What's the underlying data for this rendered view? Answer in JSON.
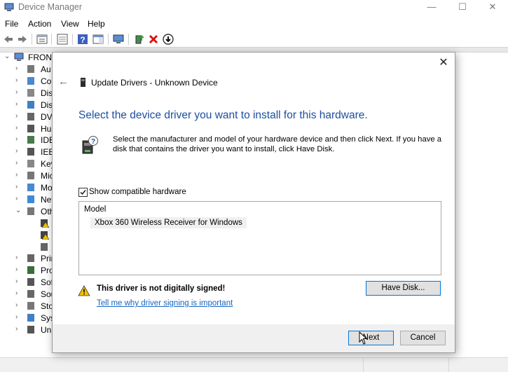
{
  "window": {
    "title": "Device Manager",
    "controls": {
      "minimize": "—",
      "maximize": "☐",
      "close": "✕"
    }
  },
  "menu": [
    "File",
    "Action",
    "View",
    "Help"
  ],
  "tree": {
    "root_label": "FRONT",
    "items": [
      {
        "label": "Au",
        "icon": "audio-icon",
        "expanded": false
      },
      {
        "label": "Cor",
        "icon": "computer-icon",
        "expanded": false
      },
      {
        "label": "Disk",
        "icon": "disk-icon",
        "expanded": false
      },
      {
        "label": "Disp",
        "icon": "display-icon",
        "expanded": false
      },
      {
        "label": "DVD",
        "icon": "dvd-icon",
        "expanded": false
      },
      {
        "label": "Hun",
        "icon": "hid-icon",
        "expanded": false
      },
      {
        "label": "IDE",
        "icon": "ide-icon",
        "expanded": false
      },
      {
        "label": "IEEE",
        "icon": "ieee-icon",
        "expanded": false
      },
      {
        "label": "Key",
        "icon": "keyboard-icon",
        "expanded": false
      },
      {
        "label": "Mic",
        "icon": "mouse-icon",
        "expanded": false
      },
      {
        "label": "Mo",
        "icon": "monitor-icon",
        "expanded": false
      },
      {
        "label": "Net",
        "icon": "network-icon",
        "expanded": false
      },
      {
        "label": "Oth",
        "icon": "other-devices-icon",
        "expanded": true
      },
      {
        "label": "",
        "icon": "unknown-device-warning-icon",
        "child": true
      },
      {
        "label": "",
        "icon": "unknown-device-warning-icon",
        "child": true
      },
      {
        "label": "",
        "icon": "unknown-device-icon",
        "child": true
      },
      {
        "label": "Prin",
        "icon": "printer-icon",
        "expanded": false
      },
      {
        "label": "Pro",
        "icon": "processor-icon",
        "expanded": false
      },
      {
        "label": "Sof",
        "icon": "software-icon",
        "expanded": false
      },
      {
        "label": "Sou",
        "icon": "sound-icon",
        "expanded": false
      },
      {
        "label": "Sto",
        "icon": "storage-icon",
        "expanded": false
      },
      {
        "label": "Syst",
        "icon": "system-icon",
        "expanded": false
      },
      {
        "label": "Uni",
        "icon": "usb-icon",
        "expanded": false
      }
    ]
  },
  "dialog": {
    "title": "Update Drivers - Unknown Device",
    "heading": "Select the device driver you want to install for this hardware.",
    "instructions": "Select the manufacturer and model of your hardware device and then click Next. If you have a disk that contains the driver you want to install, click Have Disk.",
    "show_compatible_label": "Show compatible hardware",
    "show_compatible_checked": true,
    "model_header": "Model",
    "models": [
      "Xbox 360 Wireless Receiver for Windows"
    ],
    "warning_text": "This driver is not digitally signed!",
    "warning_link": "Tell me why driver signing is important",
    "have_disk_label": "Have Disk...",
    "next_label": "Next",
    "cancel_label": "Cancel",
    "close_glyph": "✕",
    "back_glyph": "←"
  },
  "colors": {
    "heading_blue": "#1c4fa0",
    "link_blue": "#1565c0",
    "focus_border": "#0078d7",
    "warning_yellow": "#f2c200"
  }
}
